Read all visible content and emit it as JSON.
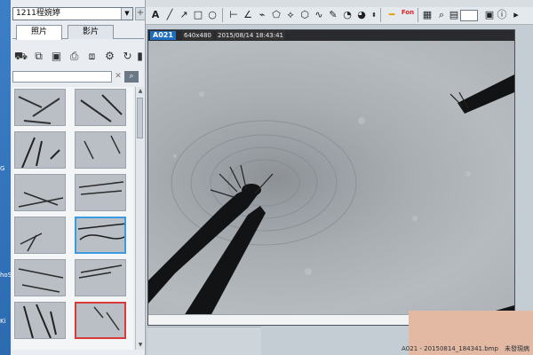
{
  "client": {
    "name": "1211程婉婷"
  },
  "tabs": [
    {
      "label": "照片",
      "active": true
    },
    {
      "label": "影片",
      "active": false
    }
  ],
  "search": {
    "placeholder": ""
  },
  "desktop_strip": [
    "G",
    "hoS",
    "Ki"
  ],
  "viewer": {
    "image_id": "A021",
    "resolution": "640x480",
    "timestamp": "2015/08/14 18:43:41"
  },
  "status": {
    "filename": "A021 - 20150814_184341.bmp",
    "state": "未發現病"
  },
  "colors": {
    "accent_blue": "#1e6fc4",
    "selected_blue": "#3c9be0",
    "selected_red": "#d83a3a"
  }
}
